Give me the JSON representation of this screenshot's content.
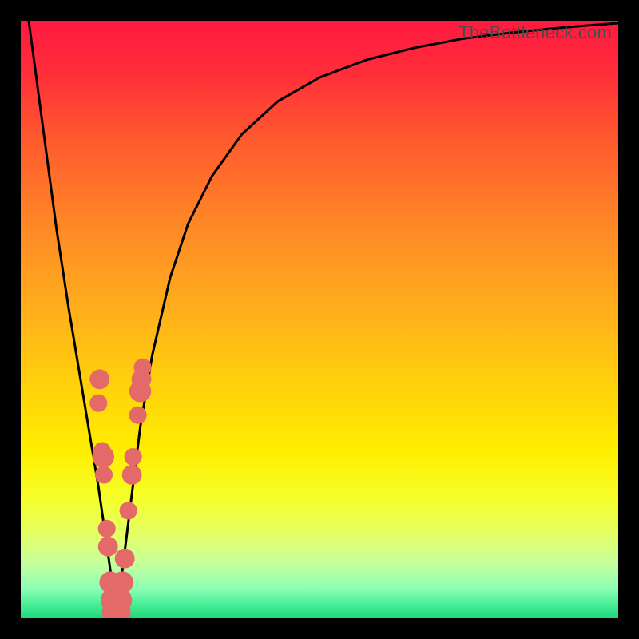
{
  "watermark": {
    "text": "TheBottleneck.com"
  },
  "colors": {
    "frame": "#000000",
    "curve": "#000000",
    "marker_fill": "#e46a6a",
    "marker_stroke": "#b03232",
    "gradient_stops": [
      {
        "offset": 0.0,
        "color": "#ff1a40"
      },
      {
        "offset": 0.08,
        "color": "#ff2b3a"
      },
      {
        "offset": 0.2,
        "color": "#ff5a2e"
      },
      {
        "offset": 0.35,
        "color": "#ff8a26"
      },
      {
        "offset": 0.5,
        "color": "#ffb31a"
      },
      {
        "offset": 0.62,
        "color": "#ffd40a"
      },
      {
        "offset": 0.72,
        "color": "#ffee00"
      },
      {
        "offset": 0.8,
        "color": "#f6ff2a"
      },
      {
        "offset": 0.86,
        "color": "#e4ff66"
      },
      {
        "offset": 0.91,
        "color": "#c4ff9e"
      },
      {
        "offset": 0.95,
        "color": "#8dffb4"
      },
      {
        "offset": 0.975,
        "color": "#4cf09a"
      },
      {
        "offset": 1.0,
        "color": "#1ed87a"
      }
    ]
  },
  "chart_data": {
    "type": "line",
    "title": "",
    "xlabel": "",
    "ylabel": "",
    "xlim": [
      0,
      100
    ],
    "ylim": [
      0,
      100
    ],
    "series": [
      {
        "name": "bottleneck-curve",
        "x": [
          0,
          2,
          4,
          6,
          8,
          10,
          12,
          13,
          14,
          15,
          15.7,
          16.3,
          17,
          18,
          19,
          20,
          22,
          25,
          28,
          32,
          37,
          43,
          50,
          58,
          66,
          74,
          82,
          90,
          96,
          100
        ],
        "y": [
          110,
          95,
          80,
          65,
          52,
          40,
          28,
          22,
          15,
          8,
          2,
          2,
          8,
          16,
          24,
          32,
          44,
          57,
          66,
          74,
          81,
          86.5,
          90.5,
          93.5,
          95.5,
          97,
          98,
          98.8,
          99.3,
          99.6
        ]
      }
    ],
    "markers": {
      "name": "data-points",
      "points": [
        {
          "x": 13.2,
          "y": 40,
          "r": 1.4
        },
        {
          "x": 13.0,
          "y": 36,
          "r": 1.2
        },
        {
          "x": 13.6,
          "y": 28,
          "r": 1.2
        },
        {
          "x": 13.8,
          "y": 27,
          "r": 1.6
        },
        {
          "x": 13.9,
          "y": 24,
          "r": 1.2
        },
        {
          "x": 14.4,
          "y": 15,
          "r": 1.2
        },
        {
          "x": 14.6,
          "y": 12,
          "r": 1.4
        },
        {
          "x": 15.0,
          "y": 6,
          "r": 1.6
        },
        {
          "x": 15.4,
          "y": 3,
          "r": 1.8
        },
        {
          "x": 15.8,
          "y": 1,
          "r": 2.0
        },
        {
          "x": 16.2,
          "y": 1,
          "r": 2.0
        },
        {
          "x": 16.6,
          "y": 3,
          "r": 1.8
        },
        {
          "x": 17.0,
          "y": 6,
          "r": 1.6
        },
        {
          "x": 17.4,
          "y": 10,
          "r": 1.4
        },
        {
          "x": 18.0,
          "y": 18,
          "r": 1.2
        },
        {
          "x": 18.6,
          "y": 24,
          "r": 1.4
        },
        {
          "x": 18.8,
          "y": 27,
          "r": 1.2
        },
        {
          "x": 19.6,
          "y": 34,
          "r": 1.2
        },
        {
          "x": 20.0,
          "y": 38,
          "r": 1.6
        },
        {
          "x": 20.2,
          "y": 40,
          "r": 1.4
        },
        {
          "x": 20.4,
          "y": 42,
          "r": 1.2
        }
      ]
    }
  }
}
